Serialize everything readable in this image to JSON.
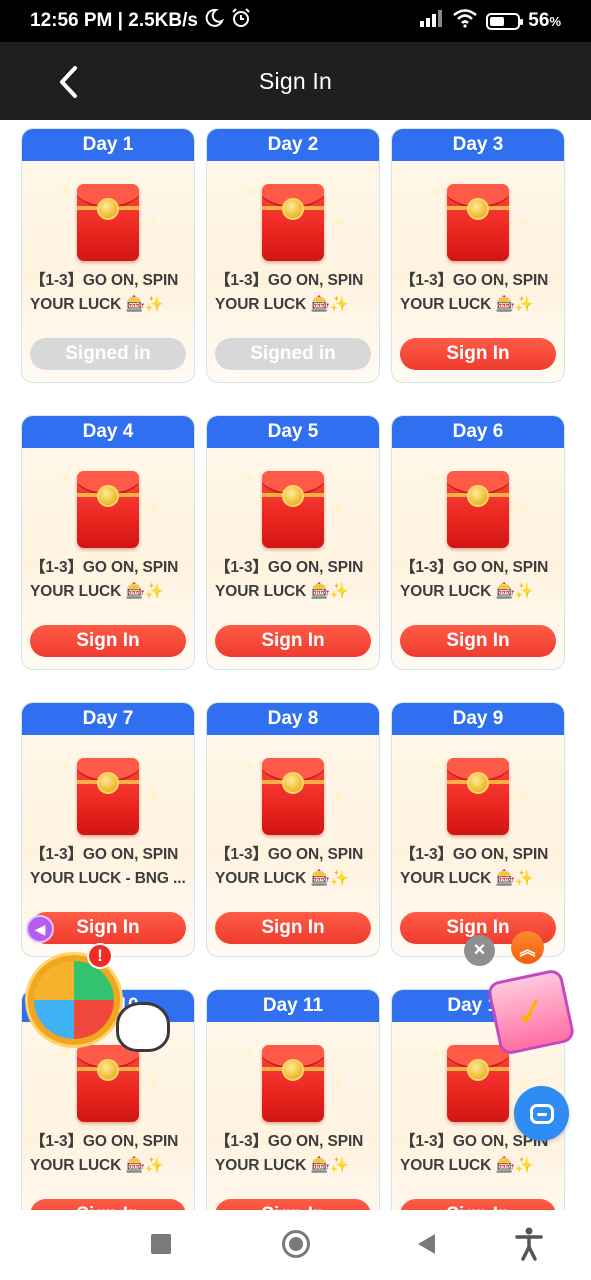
{
  "status_bar": {
    "time_speed": "12:56 PM | 2.5KB/s",
    "battery": "56"
  },
  "header": {
    "title": "Sign In"
  },
  "cards": [
    {
      "day": "Day 1",
      "line1": "【1-3】GO ON, SPIN",
      "line2": "YOUR LUCK 🎰✨",
      "button": "Signed in",
      "state": "done"
    },
    {
      "day": "Day 2",
      "line1": "【1-3】GO ON, SPIN",
      "line2": "YOUR LUCK 🎰✨",
      "button": "Signed in",
      "state": "done"
    },
    {
      "day": "Day 3",
      "line1": "【1-3】GO ON, SPIN",
      "line2": "YOUR LUCK 🎰✨",
      "button": "Sign In",
      "state": "active"
    },
    {
      "day": "Day 4",
      "line1": "【1-3】GO ON, SPIN",
      "line2": "YOUR LUCK 🎰✨",
      "button": "Sign In",
      "state": "active"
    },
    {
      "day": "Day 5",
      "line1": "【1-3】GO ON, SPIN",
      "line2": "YOUR LUCK 🎰✨",
      "button": "Sign In",
      "state": "active"
    },
    {
      "day": "Day 6",
      "line1": "【1-3】GO ON, SPIN",
      "line2": "YOUR LUCK 🎰✨",
      "button": "Sign In",
      "state": "active"
    },
    {
      "day": "Day 7",
      "line1": "【1-3】GO ON, SPIN",
      "line2": "YOUR LUCK - BNG ...",
      "button": "Sign In",
      "state": "active"
    },
    {
      "day": "Day 8",
      "line1": "【1-3】GO ON, SPIN",
      "line2": "YOUR LUCK 🎰✨",
      "button": "Sign In",
      "state": "active"
    },
    {
      "day": "Day 9",
      "line1": "【1-3】GO ON, SPIN",
      "line2": "YOUR LUCK 🎰✨",
      "button": "Sign In",
      "state": "active"
    },
    {
      "day": "Day 10",
      "line1": "【1-3】GO ON, SPIN",
      "line2": "YOUR LUCK 🎰✨",
      "button": "Sign In",
      "state": "active"
    },
    {
      "day": "Day 11",
      "line1": "【1-3】GO ON, SPIN",
      "line2": "YOUR LUCK 🎰✨",
      "button": "Sign In",
      "state": "active"
    },
    {
      "day": "Day 12",
      "line1": "【1-3】GO ON, SPIN",
      "line2": "YOUR LUCK 🎰✨",
      "button": "Sign In",
      "state": "active"
    }
  ],
  "widgets": {
    "badge": "!",
    "close": "×",
    "up": "︽"
  },
  "colors": {
    "header_bg": "#1f1f1f",
    "day_head": "#2f6ff0",
    "button_active": "#ef3b2f",
    "button_done": "#d8d8d8",
    "chat": "#2e8cf2"
  }
}
